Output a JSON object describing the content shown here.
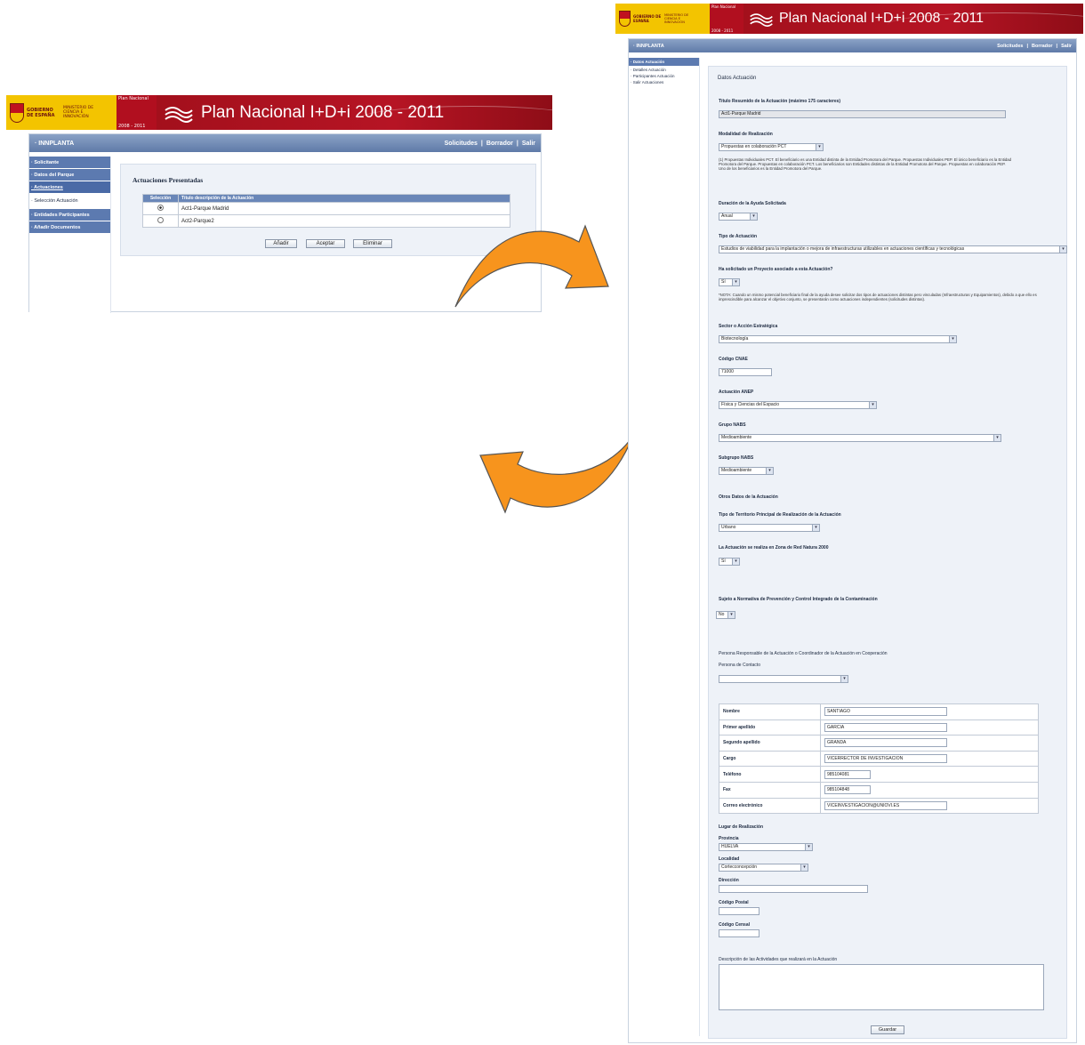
{
  "banner": {
    "gobierno": "GOBIERNO DE ESPAÑA",
    "ministerio": "MINISTERIO DE CIENCIA E INNOVACIÓN",
    "plan_small": "Plan Nacional",
    "years_small": "2008 - 2011",
    "title": "Plan Nacional I+D+i 2008 - 2011"
  },
  "left": {
    "app_name": "· INNPLANTA",
    "top_links": [
      "Solicitudes",
      "Borrador",
      "Salir"
    ],
    "sidebar": [
      {
        "label": "· Solicitante"
      },
      {
        "label": "· Datos del Parque"
      },
      {
        "label": "· Actuaciones"
      },
      {
        "label": "· Selección Actuación"
      },
      {
        "label": "· Entidades Participantes"
      },
      {
        "label": "· Añadir Documentos"
      }
    ],
    "section_title": "Actuaciones Presentadas",
    "table": {
      "headers": [
        "Selección",
        "Título descripción de la Actuación"
      ],
      "rows": [
        {
          "selected": true,
          "title": "Act1-Parque Madrid"
        },
        {
          "selected": false,
          "title": "Act2-Parque2"
        }
      ]
    },
    "buttons": {
      "add": "Añadir",
      "accept": "Aceptar",
      "delete": "Eliminar"
    }
  },
  "right": {
    "app_name": "· INNPLANTA",
    "top_links": [
      "Solicitudes",
      "Borrador",
      "Salir"
    ],
    "sidebar": [
      "· Datos Actuación",
      "· Detalles Actuación",
      "· Participantes Actuación",
      "· Salir Actuaciones"
    ],
    "form": {
      "section_title": "Datos Actuación",
      "titulo_label": "Título Resumido de la Actuación (máximo 175 caracteres)",
      "titulo_value": "Act1-Parque Madrid",
      "modalidad_label": "Modalidad de Realización",
      "modalidad_value": "Propuestas en colaboración PCT",
      "modalidad_note": "(1) Propuestas Individuales PCT. El beneficiario es una Entidad distinta de la Entidad Promotora del Parque. Propuestas Individuales PEP. El único beneficiario es la Entidad Promotora del Parque. Propuestas en colaboración PCT. Los beneficiarios son Entidades distintas de la Entidad Promotora del Parque. Propuestas en colaboración PEP. Uno de los beneficiarios es la Entidad Promotora del Parque.",
      "duracion_label": "Duración de la Ayuda Solicitada",
      "duracion_value": "Anual",
      "tipo_label": "Tipo de Actuación",
      "tipo_value": "Estudios de viabilidad para la implantación o mejora de infraestructuras utilizables en actuaciones científicas y tecnológicas",
      "proyecto_label": "Ha solicitado un Proyecto asociado a esta Actuación?",
      "proyecto_value": "Sí",
      "proyecto_note": "*NOTA: Cuando un mismo potencial beneficiario final de la ayuda desee solicitar dos tipos de actuaciones distintas pero vinculadas (Infraestructuras y Equipamientos), debido a que ello es imprescindible para alcanzar el objetivo conjunto, se presentarán como actuaciones independientes (solicitudes distintas).",
      "sector_label": "Sector o Acción Estratégica",
      "sector_value": "Biotecnología",
      "cnae_label": "Código CNAE",
      "cnae_value": "71000",
      "aneo_label": "Actuación ANEP",
      "aneo_value": "Física y Ciencias del Espacio",
      "grupo_label": "Grupo NABS",
      "grupo_value": "Medioambiente",
      "subgrupo_label": "Subgrupo NABS",
      "subgrupo_value": "Medioambiente",
      "otros_label": "Otros Datos de la Actuación",
      "territorio_label": "Tipo de Territorio Principal de Realización de la Actuación",
      "territorio_value": "Urbano",
      "natura_label": "La Actuación se realiza en Zona de Red Natura 2000",
      "natura_value": "Sí",
      "sujeto_label": "Sujeto a Normativa de Prevención y Control Integrado de la Contaminación",
      "sujeto_value": "No",
      "responsable_label": "Persona Responsable de la Actuación o Coordinador de la Actuación en Cooperación",
      "contacto_label": "Persona de Contacto",
      "contacto_value": "",
      "contact": [
        {
          "key": "Nombre",
          "value": "SANTIAGO"
        },
        {
          "key": "Primer apellido",
          "value": "GARCIA"
        },
        {
          "key": "Segundo apellido",
          "value": "GRANDA"
        },
        {
          "key": "Cargo",
          "value": "VICERRECTOR DE INVESTIGACION"
        },
        {
          "key": "Teléfono",
          "value": "985104081"
        },
        {
          "key": "Fax",
          "value": "985104848"
        },
        {
          "key": "Correo electrónico",
          "value": "VICEINVESTIGACION@UNIOVI.ES"
        }
      ],
      "lugar_label": "Lugar de Realización",
      "provincia_label": "Provincia",
      "provincia_value": "HUELVA",
      "localidad_label": "Localidad",
      "localidad_value": "Cortecconcepción",
      "direccion_label": "Dirección",
      "direccion_value": "",
      "postal_label": "Código Postal",
      "postal_value": "",
      "censal_label": "Código Censal",
      "censal_value": "",
      "descripcion_label": "Descripción de las Actividades que realizará en la Actuación",
      "descripcion_value": "",
      "save_label": "Guardar"
    }
  },
  "colors": {
    "banner_red": "#b10f1f",
    "banner_yellow": "#f3c400",
    "nav_blue": "#5c7ab0",
    "arrow_orange": "#f7941d"
  },
  "icons": [
    "spain-shield-icon",
    "plan-waves-icon",
    "radio-icon",
    "dropdown-arrow-icon",
    "curved-arrow-right-icon",
    "curved-arrow-left-icon"
  ]
}
